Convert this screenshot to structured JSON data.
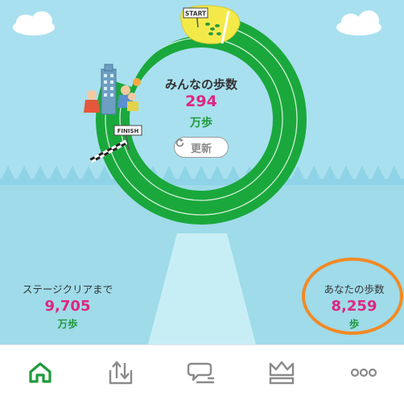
{
  "everyone": {
    "title": "みんなの歩数",
    "total": "294",
    "unit": "万歩",
    "refresh_label": "更新"
  },
  "track": {
    "start_sign": "START",
    "finish_sign": "FINISH"
  },
  "stage_remaining": {
    "label": "ステージクリアまで",
    "value": "9,705",
    "unit": "万歩"
  },
  "my_steps": {
    "label": "あなたの歩数",
    "value": "8,259",
    "unit": "歩"
  },
  "tabs": [
    {
      "icon": "home-icon",
      "active": true
    },
    {
      "icon": "upload-icon",
      "active": false
    },
    {
      "icon": "message-icon",
      "active": false
    },
    {
      "icon": "crown-icon",
      "active": false
    },
    {
      "icon": "more-icon",
      "active": false
    }
  ],
  "colors": {
    "accent_pink": "#e0267f",
    "track_green": "#1aa83c",
    "tab_active": "#1f9a3a",
    "highlight_orange": "#f28a24"
  }
}
